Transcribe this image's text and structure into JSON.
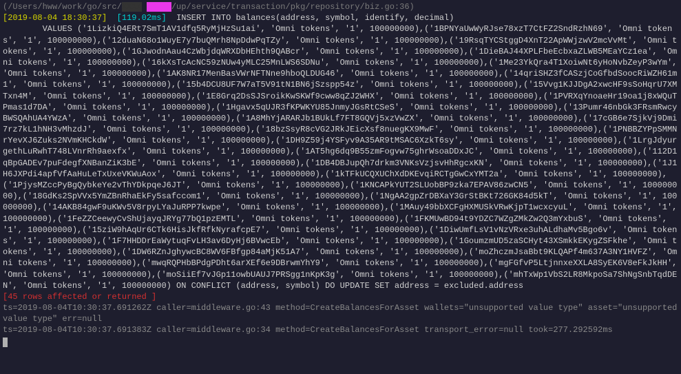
{
  "path": {
    "prefix": "(/Users/hww/work/go/src/",
    "mid": "/up/service/transaction/pkg/repository/biz.go:36)"
  },
  "header": {
    "timestamp": "[2019-08-04 18:30:37]",
    "duration": "[119.02ms]",
    "sql_start": "INSERT INTO balances(address, symbol, identify, decimal)"
  },
  "sql_body": "        VALUES ('1LizkiQ4ERt7SmT1AV1dfq5RyMjHzSu1ai', 'Omni tokens', '1', 100000000),('1BPNYaUwWyRJse78xzT7CtFZ2SndRzhN69', 'Omni tokens', '1', 100000000),('12duaN68o1WuyE7y7buQMrh8NpDdwPqTZy', 'Omni tokens', '1', 100000000),('19RsqTYCStggD4XnT22ApWWjzwV2mcVvMt', 'Omni tokens', '1', 100000000),('1GJwodnAau4CzWbjdqWRXDbHEhth9QABcr', 'Omni tokens', '1', 100000000),('1DieBAJ44XPLFbeEcbxaZLWB5MEaYCz1ea', 'Omni tokens', '1', 100000000),('16kXsTcAcNC59zNUw4yMLC25MnLWS6SDNu', 'Omni tokens', '1', 100000000),('1Me23YkQra4T1XoiwNt6yHoNvbZeyP3wYm', 'Omni tokens', '1', 100000000),('1AK8NR17MenBasVWrNFTNne9hboQLDUG46', 'Omni tokens', '1', 100000000),('14qriSHZ3fCASzjCoGfbdSoocRiWZH61m1', 'Omni tokens', '1', 100000000),('15b4DCU8UF7W7aT5V91tN1BN6jSzspp54z', 'Omni tokens', '1', 100000000),('15Vvg1KJJDgA2xwcHF9sSoHqrU7XMTxn4M', 'Omni tokens', '1', 100000000),('1E8Grq2DsSJSroikKwSKWf9cww8qZJ2WHX', 'Omni tokens', '1', 100000000),('1PVRXqYnoaeHr19oa1j8xWQuTPmas1d7DA', 'Omni tokens', '1', 100000000),('1Hgavx5qUJR3fKPWKYU85JnmyJGsRtCSeS', 'Omni tokens', '1', 100000000),('13Pumr46nbGk3FRsmRwcyBWSQAhUA4YWzA', 'Omni tokens', '1', 100000000),('1A8MhYjARARJb1BUkLf7FT8GQVj5xzVwZX', 'Omni tokens', '1', 100000000),('17cGB6e7SjkVj9Dmi7rz7kL1hNH3vMhzdJ', 'Omni tokens', '1', 100000000),('18bzSsyR8cVG2JRkJEicXsf8nuegKX9MwF', 'Omni tokens', '1', 100000000),('1PNBBZYPpSMMNrYevXJ6Zuks2NVmKHCkdW', 'Omni tokens', '1', 100000000),('1DH9Z59j4YSFyv9A35AR9tMSAC6XzkT6sy', 'Omni tokens', '1', 100000000),('1LrgJdyurgethLuRwhT748LVnrRh9aexfx', 'Omni tokens', '1', 100000000),('1AT5hg6dq9B55zmFogvw75ghrWsoaDDxJC', 'Omni tokens', '1', 100000000),('112D1qBpGADEv7puFdegfXNBanZiK3bE', 'Omni tokens', '1', 100000000),('1DB4DBJupQh7drkm3VNKsVzjsvHhRgcxKN', 'Omni tokens', '1', 100000000),('1J1H6JXPdi4apfVfAaHuLeTxUxeVKWuAox', 'Omni tokens', '1', 100000000),('1kTFkUCQXUChXdDKEvqiRCTgGwCxYMT2a', 'Omni tokens', '1', 100000000),('1PjysMZccPyBgQybkeYe2vThYDkpqeJ6JT', 'Omni tokens', '1', 100000000),('1KNCAPkYUT2SLUobBP9zka7EPAV86zwCN5', 'Omni tokens', '1', 100000000),('18GdKs2SpVVx5YmZBnRhaEkFy5safccom1', 'Omni tokens', '1', 100000000),('1NgAA2gpZrDBXaY3GrStBKt726GK84d5kT', 'Omni tokens', '1', 100000000),('14AKB84gwF9uKWv5V8rpyLYaJuRPP7kwpe', 'Omni tokens', '1', 100000000),('1MAuy49bbXCFgHXMUSkVRwKjpT1wcxcyuL', 'Omni tokens', '1', 100000000),('1FeZZCeewyCvShUjayqJRYg77bQ1pzEMTL', 'Omni tokens', '1', 100000000),('1FKMUwBD94t9YDZC7WZgZMkZw2Q3mYxbuS', 'Omni tokens', '1', 100000000),('15ziW9hAqUr6CTk6HisJkfRfkNyrafcpE7', 'Omni tokens', '1', 100000000),('1DiwUmfLsV1vNzVRxe3uhALdhaMv5Bgo6v', 'Omni tokens', '1', 100000000),('1F7HHDDrEaWytuqFvLH3av6DyHj6BVwcEb', 'Omni tokens', '1', 100000000),('1GoumzmUD5zaSCHyt43XSmkkEKygZSFkhe', 'Omni tokens', '1', 100000000),('1DW6RZnJghywcBC8WV6FBfgp84aMjK51A7', 'Omni tokens', '1', 100000000),('moZhczmJsaBbt9KLQAPf4m637A3NY1HVFZ', 'Omni tokens', '1', 100000000),('mwqRQPHbBPdgPDht6arXEf6e9DBrwmYhY9', 'Omni tokens', '1', 100000000),('mgFGfvP5LtjnnxeXXLA8SyEK6V8eFkJkHH', 'Omni tokens', '1', 100000000),('moSiiEf7vJGp11owbUAUJ7PRSgg1nKpK3g', 'Omni tokens', '1', 100000000),('mhTxWp1VbS2LR8MkpoSa7ShNgSnbTqdDEN', 'Omni tokens', '1', 100000000) ON CONFLICT (address, symbol) DO UPDATE SET address = excluded.address",
  "affected": "[45 rows affected or returned ]",
  "log1": "ts=2019-08-04T10:30:37.691262Z caller=middleware.go:43 method=CreateBalancesForAsset wallets=\"unsupported value type\" asset=\"unsupported value type\" err=null",
  "log2": "ts=2019-08-04T10:30:37.691383Z caller=middleware.go:34 method=CreateBalancesForAsset transport_error=null took=277.292592ms"
}
